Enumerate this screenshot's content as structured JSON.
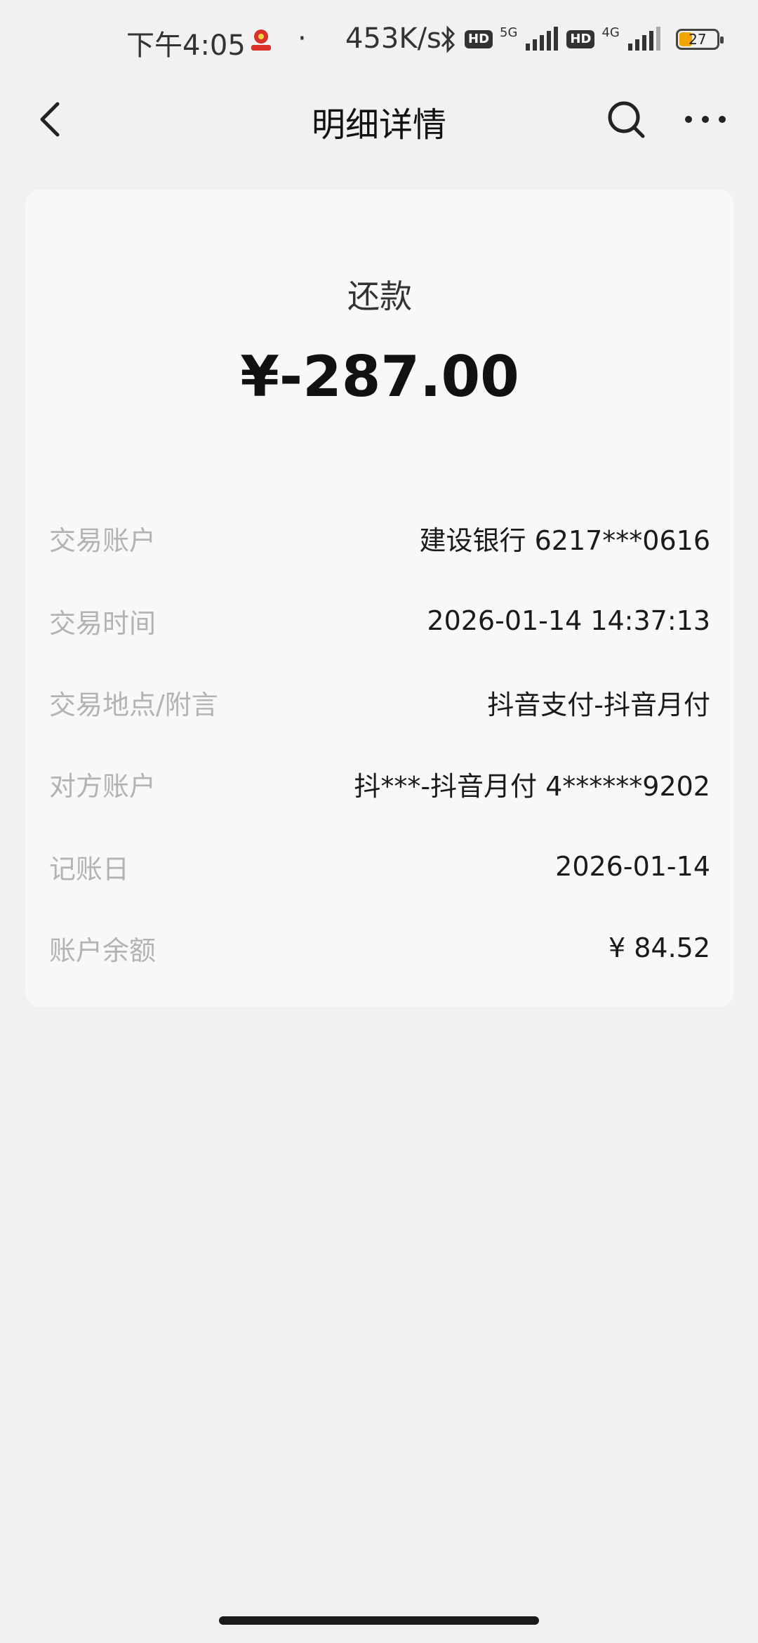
{
  "status_bar": {
    "time": "下午4:05",
    "app_icon": "red-badge-icon",
    "dot": "·",
    "net_speed": "453K/s",
    "bluetooth_icon": "bluetooth-icon",
    "hd_label": "HD",
    "net_1": "5G",
    "net_2": "4G",
    "battery": "27",
    "battery_color": "#f0a500"
  },
  "nav": {
    "title": "明细详情",
    "back_icon": "chevron-left-icon",
    "search_icon": "search-icon",
    "more_icon": "more-horizontal-icon"
  },
  "transaction": {
    "type": "还款",
    "amount": "¥-287.00",
    "details": [
      {
        "label": "交易账户",
        "value": "建设银行 6217***0616"
      },
      {
        "label": "交易时间",
        "value": "2026-01-14 14:37:13"
      },
      {
        "label": "交易地点/附言",
        "value": "抖音支付-抖音月付"
      },
      {
        "label": "对方账户",
        "value": "抖***-抖音月付 4******9202"
      },
      {
        "label": "记账日",
        "value": "2026-01-14"
      },
      {
        "label": "账户余额",
        "value": "¥ 84.52"
      }
    ]
  }
}
